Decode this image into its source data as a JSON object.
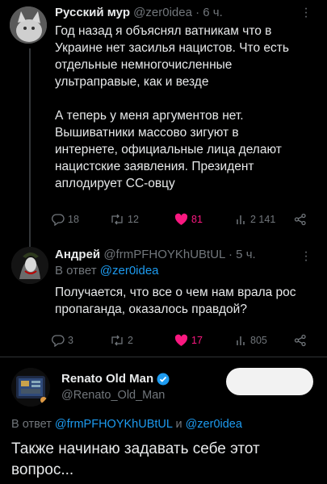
{
  "tweets": [
    {
      "name": "Русский мур",
      "handle": "@zer0idea",
      "time": "· 6 ч.",
      "body": "Год назад я объяснял ватникам что в\nУкраине нет засилья нацистов. Что есть\nотдельные немногочисленные\nультраправые, как и везде\n\nА теперь у меня аргументов нет.\nВышиватники массово зигуют в\nинтернете, официальные лица делают\nнацистские заявления. Президент\nаплодирует СС-овцу",
      "replies": "18",
      "reposts": "12",
      "likes": "81",
      "views": "2 141"
    },
    {
      "name": "Андрей",
      "handle": "@frmPFHOYKhUBtUL",
      "time": "· 5 ч.",
      "reply_prefix": "В ответ",
      "reply_to": "@zer0idea",
      "body": "Получается, что все о чем нам врала рос\nпропаганда, оказалось правдой?",
      "replies": "3",
      "reposts": "2",
      "likes": "17",
      "views": "805"
    },
    {
      "name": "Renato Old Man",
      "handle": "@Renato_Old_Man",
      "reply_prefix": "В ответ",
      "reply_to_1": "@frmPFHOYKhUBtUL",
      "reply_and": "и",
      "reply_to_2": "@zer0idea",
      "body": "Также начинаю задавать себе этот\nвопрос..."
    }
  ],
  "colors": {
    "accent": "#1d9bf0",
    "like": "#f91880",
    "muted": "#71767b",
    "text": "#e7e9ea"
  },
  "icons": [
    "reply-icon",
    "repost-icon",
    "heart-icon",
    "views-icon",
    "share-icon",
    "verified-icon",
    "more-icon"
  ]
}
